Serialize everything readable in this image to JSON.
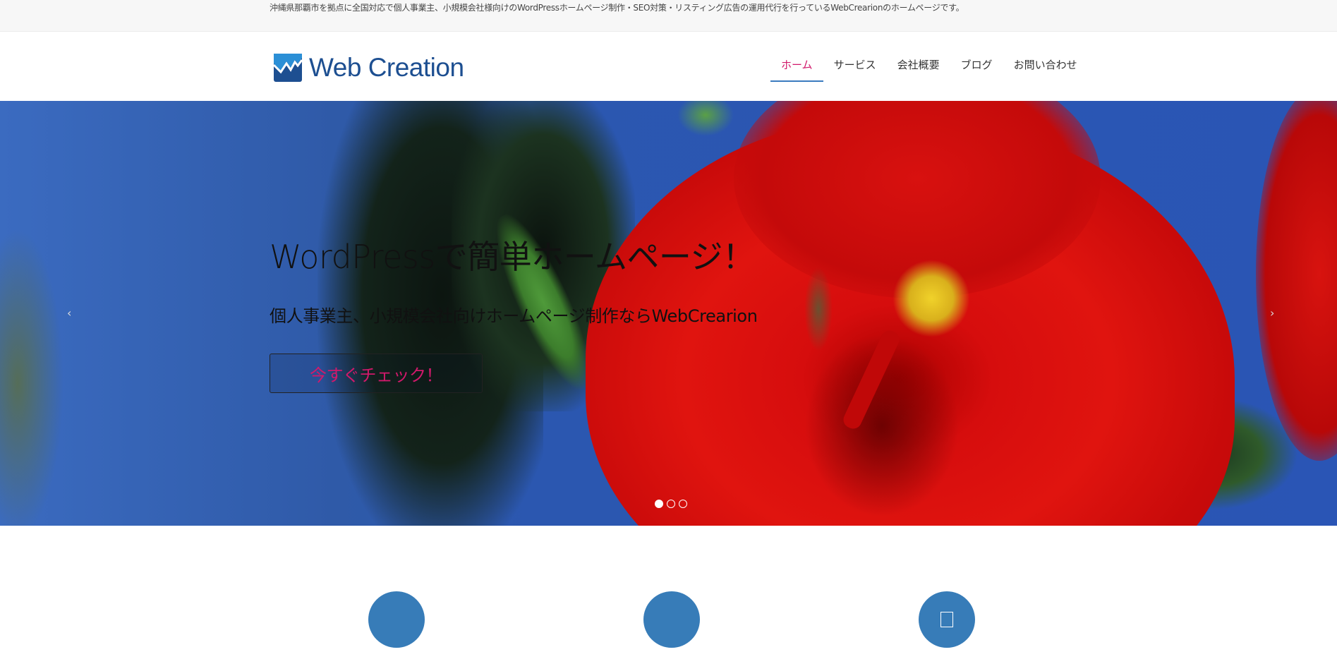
{
  "topbar": {
    "description": "沖縄県那覇市を拠点に全国対応で個人事業主、小規模会社様向けのWordPressホームページ制作・SEO対策・リスティング広告の運用代行を行っているWebCrearionのホームページです。"
  },
  "header": {
    "logo_text": "Web Creation",
    "logo_icon": "wave-chart-icon",
    "brand_colors": {
      "primary": "#1d4f91",
      "secondary": "#2b8fd6"
    }
  },
  "nav": {
    "items": [
      {
        "label": "ホーム",
        "active": true
      },
      {
        "label": "サービス",
        "active": false
      },
      {
        "label": "会社概要",
        "active": false
      },
      {
        "label": "ブログ",
        "active": false
      },
      {
        "label": "お問い合わせ",
        "active": false
      }
    ],
    "active_color": "#d1196b",
    "underline_color": "#3a7bbf"
  },
  "hero": {
    "title": "WordPressで簡単ホームページ！",
    "subtitle": "個人事業主、小規模会社向けホームページ制作ならWebCrearion",
    "cta_label": "今すぐチェック！",
    "prev_arrow": "‹",
    "next_arrow": "›",
    "slides_total": 3,
    "active_slide": 1
  },
  "features": {
    "circle_color": "#377cb8",
    "items": [
      {
        "icon": "feature-icon-1"
      },
      {
        "icon": "feature-icon-2"
      },
      {
        "icon": "missing-glyph-icon"
      }
    ]
  }
}
